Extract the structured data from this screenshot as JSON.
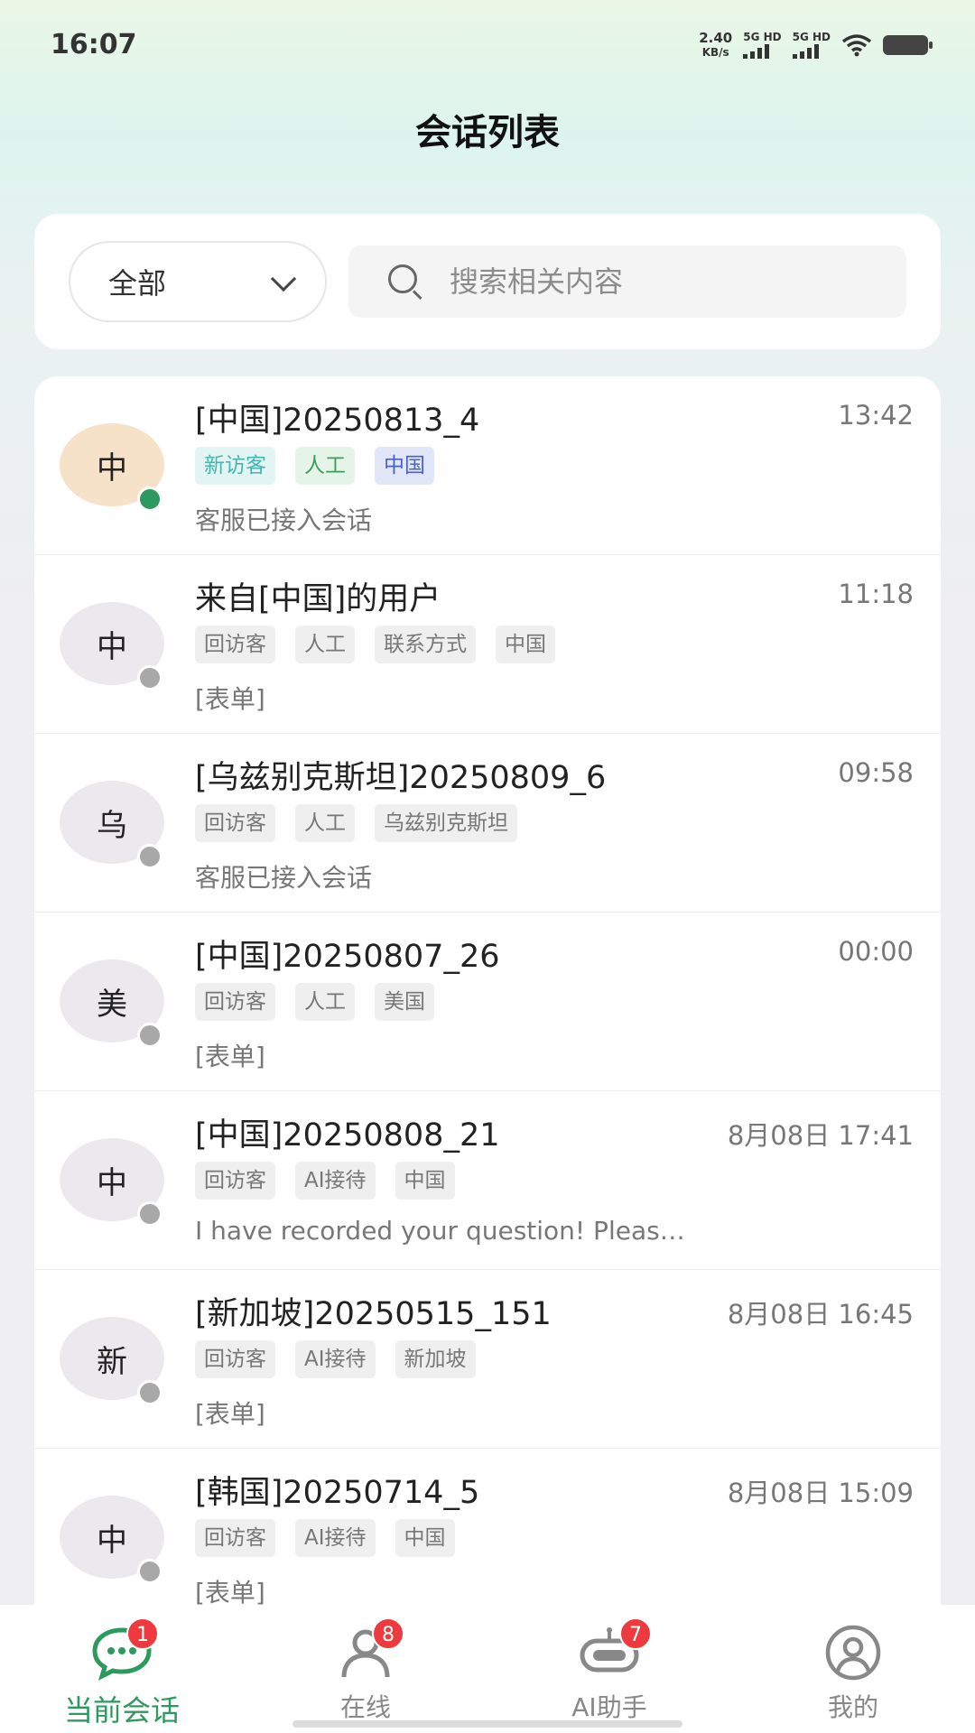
{
  "status_bar": {
    "time": "16:07",
    "net_speed": "2.40",
    "net_unit": "KB/s",
    "sim1": "5G HD",
    "sim2": "5G HD",
    "icons": [
      "signal-icon",
      "signal-icon",
      "wifi-icon",
      "battery-icon"
    ]
  },
  "header": {
    "title": "会话列表"
  },
  "filter": {
    "selected": "全部",
    "search_placeholder": "搜索相关内容"
  },
  "conversations": [
    {
      "avatar": "中",
      "online": true,
      "title": "[中国]20250813_4",
      "time": "13:42",
      "tags": [
        {
          "text": "新访客",
          "style": "teal"
        },
        {
          "text": "人工",
          "style": "green"
        },
        {
          "text": "中国",
          "style": "blue"
        }
      ],
      "message": "客服已接入会话"
    },
    {
      "avatar": "中",
      "online": false,
      "title": "来自[中国]的用户",
      "time": "11:18",
      "tags": [
        {
          "text": "回访客",
          "style": "gray"
        },
        {
          "text": "人工",
          "style": "gray"
        },
        {
          "text": "联系方式",
          "style": "gray"
        },
        {
          "text": "中国",
          "style": "gray"
        }
      ],
      "message": "[表单]"
    },
    {
      "avatar": "乌",
      "online": false,
      "title": "[乌兹别克斯坦]20250809_6",
      "time": "09:58",
      "tags": [
        {
          "text": "回访客",
          "style": "gray"
        },
        {
          "text": "人工",
          "style": "gray"
        },
        {
          "text": "乌兹别克斯坦",
          "style": "gray"
        }
      ],
      "message": "客服已接入会话"
    },
    {
      "avatar": "美",
      "online": false,
      "title": "[中国]20250807_26",
      "time": "00:00",
      "tags": [
        {
          "text": "回访客",
          "style": "gray"
        },
        {
          "text": "人工",
          "style": "gray"
        },
        {
          "text": "美国",
          "style": "gray"
        }
      ],
      "message": "[表单]"
    },
    {
      "avatar": "中",
      "online": false,
      "title": "[中国]20250808_21",
      "time": "8月08日 17:41",
      "tags": [
        {
          "text": "回访客",
          "style": "gray"
        },
        {
          "text": "AI接待",
          "style": "gray"
        },
        {
          "text": "中国",
          "style": "gray"
        }
      ],
      "message": "I have recorded your question! Pleas…"
    },
    {
      "avatar": "新",
      "online": false,
      "title": "[新加坡]20250515_151",
      "time": "8月08日 16:45",
      "tags": [
        {
          "text": "回访客",
          "style": "gray"
        },
        {
          "text": "AI接待",
          "style": "gray"
        },
        {
          "text": "新加坡",
          "style": "gray"
        }
      ],
      "message": "[表单]"
    },
    {
      "avatar": "中",
      "online": false,
      "title": "[韩国]20250714_5",
      "time": "8月08日 15:09",
      "tags": [
        {
          "text": "回访客",
          "style": "gray"
        },
        {
          "text": "AI接待",
          "style": "gray"
        },
        {
          "text": "中国",
          "style": "gray"
        }
      ],
      "message": "[表单]"
    }
  ],
  "tabs": [
    {
      "label": "当前会话",
      "icon": "chat-bubble-icon",
      "badge": "1",
      "active": true
    },
    {
      "label": "在线",
      "icon": "person-icon",
      "badge": "8",
      "active": false
    },
    {
      "label": "AI助手",
      "icon": "robot-icon",
      "badge": "7",
      "active": false
    },
    {
      "label": "我的",
      "icon": "user-circle-icon",
      "badge": "",
      "active": false
    }
  ],
  "colors": {
    "accent": "#2c9a5e",
    "badge": "#ec3a3f",
    "online": "#2c9a5e",
    "offline": "#a8a8a8"
  }
}
